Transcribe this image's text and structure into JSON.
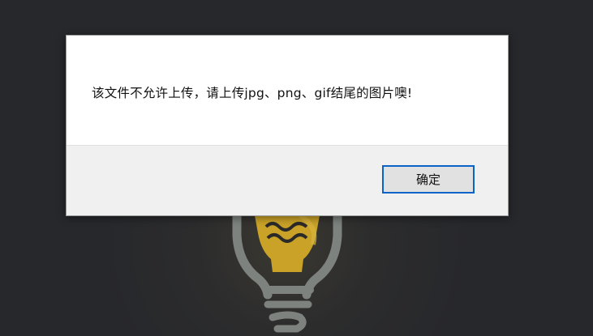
{
  "dialog": {
    "message": "该文件不允许上传，请上传jpg、png、gif结尾的图片噢!",
    "ok_label": "确定"
  },
  "background": {
    "bulb_icon": "lightbulb-icon",
    "bulb_color": "#c9a227",
    "outline_color": "#7d827f"
  }
}
